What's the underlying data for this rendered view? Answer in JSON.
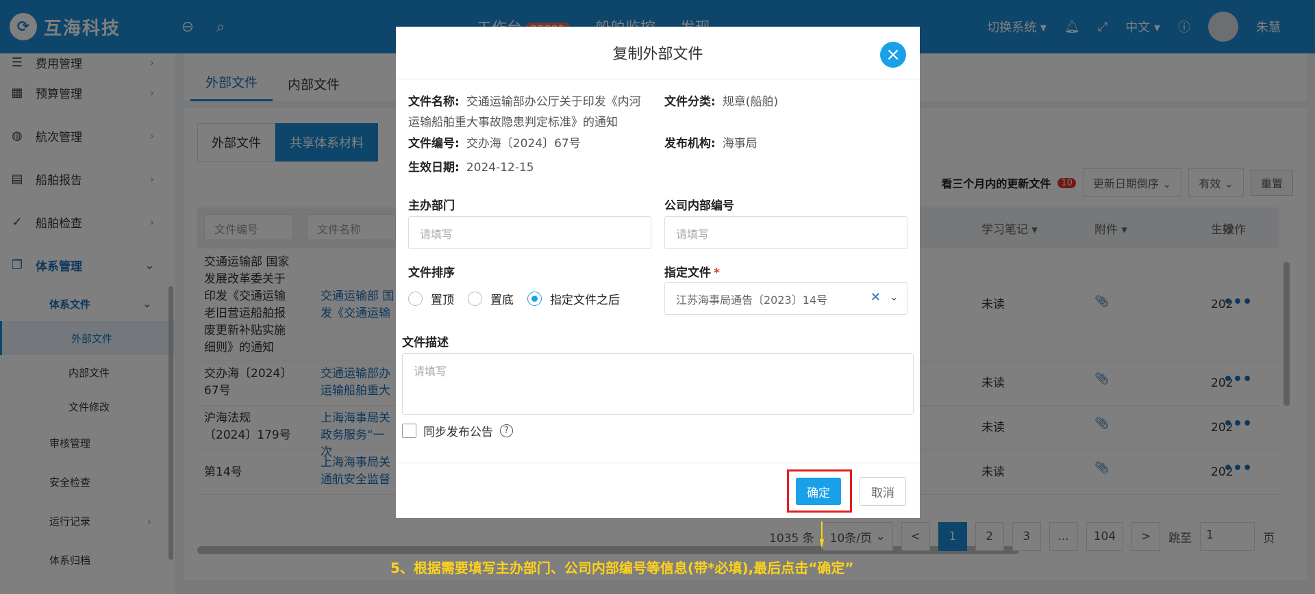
{
  "header": {
    "logo_text": "互海科技",
    "nav": [
      {
        "label": "工作台",
        "badge": "23891"
      },
      {
        "label": "船舶监控",
        "badge": ""
      },
      {
        "label": "发现",
        "badge": ""
      }
    ],
    "switch_system": "切换系统",
    "language": "中文",
    "user_name": "朱慧"
  },
  "sidebar": {
    "items": [
      {
        "label": "费用管理",
        "icon": "database-icon"
      },
      {
        "label": "预算管理",
        "icon": "calculator-icon"
      },
      {
        "label": "航次管理",
        "icon": "globe-icon"
      },
      {
        "label": "船舶报告",
        "icon": "calendar-icon"
      },
      {
        "label": "船舶检查",
        "icon": "check-circle-icon"
      },
      {
        "label": "体系管理",
        "icon": "copy-icon"
      }
    ],
    "sub_group": "体系文件",
    "sub_items": [
      "外部文件",
      "内部文件",
      "文件修改"
    ],
    "more_items": [
      "审核管理",
      "安全检查",
      "运行记录",
      "体系归档"
    ]
  },
  "main": {
    "top_tabs": [
      "外部文件",
      "内部文件"
    ],
    "sub_tabs": [
      "外部文件",
      "共享体系材料"
    ],
    "toolbar": {
      "update_text": "看三个月内的更新文件",
      "update_badge": "10",
      "sort_select": "更新日期倒序",
      "status_select": "有效",
      "reset": "重置"
    },
    "table": {
      "filters": [
        "文件编号",
        "文件名称"
      ],
      "headers": [
        "学习笔记",
        "附件",
        "生效",
        "操作"
      ],
      "rows": [
        {
          "code": "交通运输部 国家发展改革委关于印发《交通运输老旧营运船舶报废更新补贴实施细则》的通知",
          "name": "交通运输部 国发《交通运输",
          "note": "未读",
          "date": "202"
        },
        {
          "code": "交办海〔2024〕67号",
          "name": "交通运输部办运输船舶重大",
          "note": "未读",
          "date": "202"
        },
        {
          "code": "沪海法规〔2024〕179号",
          "name": "上海海事局关政务服务“一次",
          "note": "未读",
          "date": "202"
        },
        {
          "code": "第14号",
          "name": "上海海事局关通航安全监督",
          "note": "未读",
          "date": "202"
        }
      ]
    },
    "pagination": {
      "total": "1035 条",
      "page_size": "10条/页",
      "prev": "<",
      "pages": [
        "1",
        "2",
        "3",
        "...",
        "104"
      ],
      "next": ">",
      "jump_label": "跳至",
      "jump_value": "1",
      "page_unit": "页"
    }
  },
  "modal": {
    "title": "复制外部文件",
    "info": {
      "name_label": "文件名称:",
      "name_value": "交通运输部办公厅关于印发《内河运输船舶重大事故隐患判定标准》的通知",
      "category_label": "文件分类:",
      "category_value": "规章(船舶)",
      "code_label": "文件编号:",
      "code_value": "交办海〔2024〕67号",
      "org_label": "发布机构:",
      "org_value": "海事局",
      "date_label": "生效日期:",
      "date_value": "2024-12-15"
    },
    "dept_label": "主办部门",
    "dept_placeholder": "请填写",
    "internal_code_label": "公司内部编号",
    "internal_code_placeholder": "请填写",
    "sort_label": "文件排序",
    "sort_options": [
      "置顶",
      "置底",
      "指定文件之后"
    ],
    "sort_selected_index": 2,
    "target_label": "指定文件",
    "target_required": "*",
    "target_value": "江苏海事局通告〔2023〕14号",
    "desc_label": "文件描述",
    "desc_placeholder": "请填写",
    "sync_label": "同步发布公告",
    "confirm": "确定",
    "cancel": "取消"
  },
  "annotation": {
    "text": "5、根据需要填写主办部门、公司内部编号等信息(带*必填),最后点击“确定”",
    "color": "#ffd21a"
  },
  "colors": {
    "primary": "#1a8ad6",
    "modal_accent": "#1aa0e8",
    "highlight": "#e02020"
  }
}
